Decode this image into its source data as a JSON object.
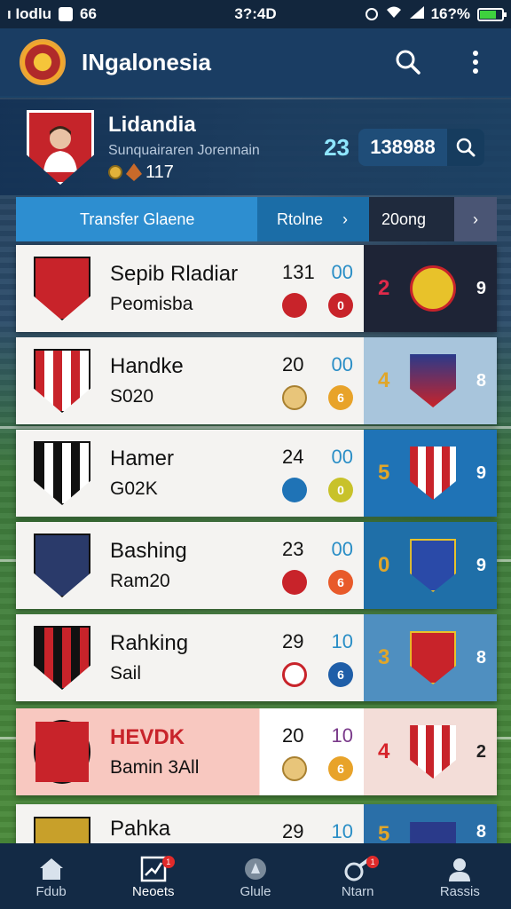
{
  "status_bar": {
    "carrier": "ı Iodlu",
    "center_time": "3?:4D",
    "app_indicator": "66",
    "battery": "16?%"
  },
  "app_bar": {
    "title": "INgalonesia"
  },
  "profile": {
    "name": "Lidandia",
    "subtitle": "Sunquairaren Jorennain",
    "score": "117",
    "count": "23",
    "search_value": "138988"
  },
  "tabs": [
    {
      "label": "Transfer Glaene"
    },
    {
      "label": "Rtolne"
    },
    {
      "label": "20ong"
    }
  ],
  "rows": [
    {
      "name": "Sepib Rladiar",
      "sub": "Peomisba",
      "stat": "131",
      "stat2": "00",
      "rank": "2",
      "count": "9",
      "rank_color": "#e02a4a",
      "right_bg": "#1e2436",
      "sub_badge": "0",
      "sub_badge_color": "#c8232a"
    },
    {
      "name": "Handke",
      "sub": "S020",
      "stat": "20",
      "stat2": "00",
      "rank": "4",
      "count": "8",
      "rank_color": "#e0a62a",
      "right_bg": "#a8c5dc",
      "sub_badge": "6",
      "sub_badge_color": "#e8a32a"
    },
    {
      "name": "Hamer",
      "sub": "G02K",
      "stat": "24",
      "stat2": "00",
      "rank": "5",
      "count": "9",
      "rank_color": "#e0a62a",
      "right_bg": "#1f73b6",
      "sub_badge": "0",
      "sub_badge_color": "#c8c22a"
    },
    {
      "name": "Bashing",
      "sub": "Ram20",
      "stat": "23",
      "stat2": "00",
      "rank": "0",
      "count": "9",
      "rank_color": "#e0a62a",
      "right_bg": "#1f6fa8",
      "sub_badge": "6",
      "sub_badge_color": "#e85a2a"
    },
    {
      "name": "Rahking",
      "sub": "Sail",
      "stat": "29",
      "stat2": "10",
      "rank": "3",
      "count": "8",
      "rank_color": "#e0a62a",
      "right_bg": "#4f8fc0",
      "sub_badge": "6",
      "sub_badge_color": "#1f5ea8"
    },
    {
      "name": "HEVDK",
      "sub": "Bamin 3All",
      "stat": "20",
      "stat2": "10",
      "rank": "4",
      "count": "2",
      "rank_color": "#d6232a",
      "right_bg": "#f3ddd8",
      "sub_badge": "6",
      "sub_badge_color": "#e8a32a"
    },
    {
      "name": "Pahka",
      "sub": "",
      "stat": "29",
      "stat2": "10",
      "rank": "5",
      "count": "8",
      "rank_color": "#e0a62a",
      "right_bg": "#2a6fa8",
      "sub_badge": "",
      "sub_badge_color": "#e8a32a"
    }
  ],
  "bottom_nav": [
    {
      "label": "Fdub",
      "icon": "home-icon"
    },
    {
      "label": "Neoets",
      "icon": "chart-icon",
      "badge": "1"
    },
    {
      "label": "Glule",
      "icon": "globe-icon"
    },
    {
      "label": "Ntarn",
      "icon": "whistle-icon",
      "badge": "1"
    },
    {
      "label": "Rassis",
      "icon": "person-icon"
    }
  ]
}
